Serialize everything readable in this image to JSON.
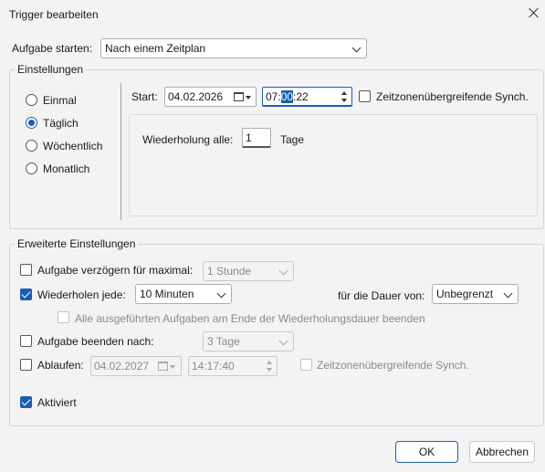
{
  "window": {
    "title": "Trigger bearbeiten",
    "close_icon": "close-icon"
  },
  "task": {
    "label": "Aufgabe starten:",
    "value": "Nach einem Zeitplan"
  },
  "settings": {
    "group_label": "Einstellungen",
    "schedule_options": [
      {
        "label": "Einmal",
        "selected": false
      },
      {
        "label": "Täglich",
        "selected": true
      },
      {
        "label": "Wöchentlich",
        "selected": false
      },
      {
        "label": "Monatlich",
        "selected": false
      }
    ],
    "start_label": "Start:",
    "start_date": "04.02.2026",
    "start_time_hours": "07:",
    "start_time_minutes": "00",
    "start_time_seconds": ":22",
    "sync_label": "Zeitzonenübergreifende Synch.",
    "sync_checked": false,
    "repeat_label": "Wiederholung alle:",
    "repeat_value": "1",
    "repeat_unit": "Tage"
  },
  "advanced": {
    "group_label": "Erweiterte Einstellungen",
    "delay": {
      "label": "Aufgabe verzögern für maximal:",
      "checked": false,
      "value": "1 Stunde"
    },
    "repeat": {
      "label": "Wiederholen jede:",
      "checked": true,
      "value": "10 Minuten",
      "duration_label": "für die Dauer von:",
      "duration_value": "Unbegrenzt"
    },
    "stop_all": {
      "label": "Alle ausgeführten Aufgaben am Ende der Wiederholungsdauer beenden",
      "checked": false
    },
    "stop_after": {
      "label": "Aufgabe beenden nach:",
      "checked": false,
      "value": "3 Tage"
    },
    "expire": {
      "label": "Ablaufen:",
      "checked": false,
      "date": "04.02.2027",
      "time": "14:17:40",
      "sync_label": "Zeitzonenübergreifende Synch."
    },
    "enabled": {
      "label": "Aktiviert",
      "checked": true
    }
  },
  "buttons": {
    "ok": "OK",
    "cancel": "Abbrechen"
  },
  "colors": {
    "accent": "#1a5fb4",
    "background": "#f3f3f3"
  }
}
